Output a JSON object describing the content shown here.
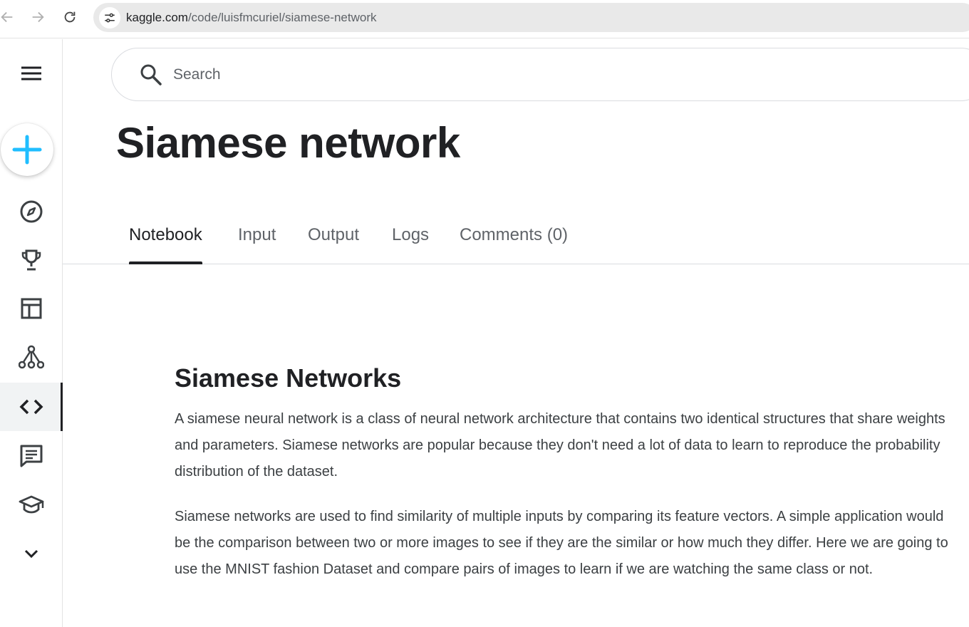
{
  "browser": {
    "url_host": "kaggle.com",
    "url_path": "/code/luisfmcuriel/siamese-network"
  },
  "search": {
    "placeholder": "Search"
  },
  "page": {
    "title": "Siamese network"
  },
  "tabs": [
    {
      "label": "Notebook",
      "active": true
    },
    {
      "label": "Input"
    },
    {
      "label": "Output"
    },
    {
      "label": "Logs"
    },
    {
      "label": "Comments (0)"
    }
  ],
  "rail": {
    "items": [
      {
        "icon": "menu-icon"
      },
      {
        "icon": "plus-icon"
      },
      {
        "icon": "compass-icon"
      },
      {
        "icon": "trophy-icon"
      },
      {
        "icon": "table-icon"
      },
      {
        "icon": "models-icon"
      },
      {
        "icon": "code-icon",
        "active": true
      },
      {
        "icon": "discussion-icon"
      },
      {
        "icon": "learn-icon"
      },
      {
        "icon": "chevron-down-icon"
      }
    ]
  },
  "notebook": {
    "heading": "Siamese Networks",
    "paragraphs": [
      "A siamese neural network is a class of neural network architecture that contains two identical structures that share weights and parameters. Siamese networks are popular because they don't need a lot of data to learn to reproduce the probability distribution of the dataset.",
      "Siamese networks are used to find similarity of multiple inputs by comparing its feature vectors. A simple application would be the comparison between two or more images to see if they are the similar or how much they differ. Here we are going to use the MNIST fashion Dataset and compare pairs of images to learn if we are watching the same class or not."
    ]
  },
  "colors": {
    "accent": "#20beff",
    "text": "#202124",
    "muted": "#5f6368"
  }
}
